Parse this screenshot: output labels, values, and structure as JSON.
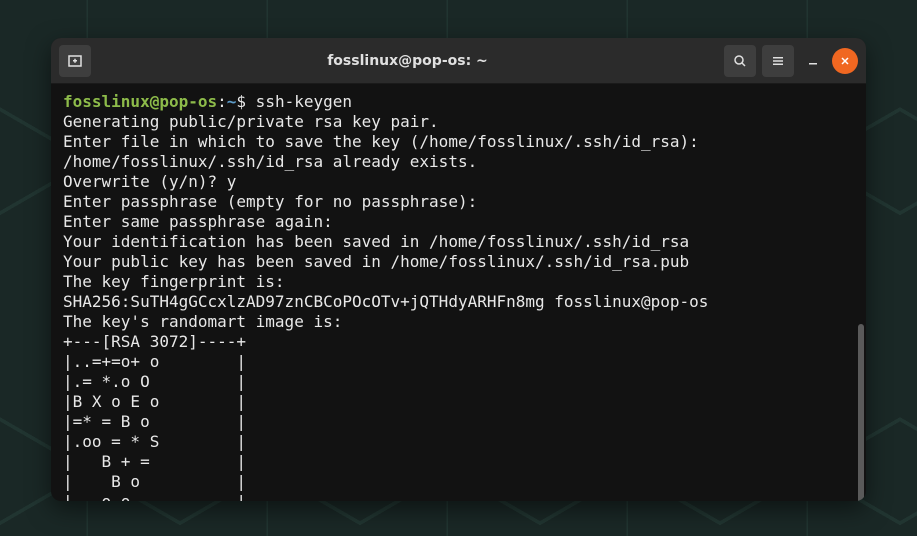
{
  "window": {
    "title": "fosslinux@pop-os: ~"
  },
  "prompt": {
    "user_host": "fosslinux@pop-os",
    "colon": ":",
    "path": "~",
    "symbol": "$",
    "command": " ssh-keygen"
  },
  "output": {
    "l0": "Generating public/private rsa key pair.",
    "l1": "Enter file in which to save the key (/home/fosslinux/.ssh/id_rsa):",
    "l2": "/home/fosslinux/.ssh/id_rsa already exists.",
    "l3": "Overwrite (y/n)? y",
    "l4": "Enter passphrase (empty for no passphrase):",
    "l5": "Enter same passphrase again:",
    "l6": "Your identification has been saved in /home/fosslinux/.ssh/id_rsa",
    "l7": "Your public key has been saved in /home/fosslinux/.ssh/id_rsa.pub",
    "l8": "The key fingerprint is:",
    "l9": "SHA256:SuTH4gGCcxlzAD97znCBCoPOcOTv+jQTHdyARHFn8mg fosslinux@pop-os",
    "l10": "The key's randomart image is:",
    "l11": "+---[RSA 3072]----+",
    "l12": "|..=+=o+ o        |",
    "l13": "|.= *.o O         |",
    "l14": "|B X o E o        |",
    "l15": "|=* = B o         |",
    "l16": "|.oo = * S        |",
    "l17": "|   B + =         |",
    "l18": "|    B o          |",
    "l19": "|   o o           |"
  }
}
